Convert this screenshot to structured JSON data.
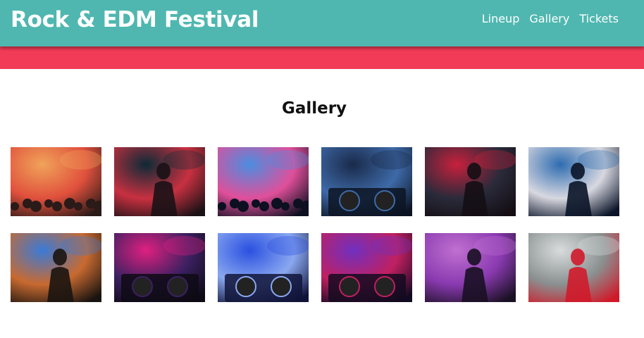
{
  "header": {
    "title": "Rock & EDM Festival",
    "nav": [
      {
        "label": "Lineup"
      },
      {
        "label": "Gallery"
      },
      {
        "label": "Tickets"
      }
    ]
  },
  "main": {
    "heading": "Gallery",
    "photos": [
      {
        "subject": "crowd-concert-sunset",
        "colors": [
          "#f0a35a",
          "#e0503c",
          "#2a1a18"
        ]
      },
      {
        "subject": "rock-singer-stage",
        "colors": [
          "#0d2a36",
          "#c83040",
          "#1a1216"
        ]
      },
      {
        "subject": "edm-crowd-lights",
        "colors": [
          "#4a8de0",
          "#e04f9a",
          "#0c1020"
        ]
      },
      {
        "subject": "dj-turntables",
        "colors": [
          "#1a2a4a",
          "#3e6aa8",
          "#0c1422"
        ]
      },
      {
        "subject": "guitarist-red-light",
        "colors": [
          "#c8203c",
          "#2a2a3a",
          "#140e14"
        ]
      },
      {
        "subject": "guitarist-blue-stage",
        "colors": [
          "#2e6cb0",
          "#d8d8e0",
          "#0a1428"
        ]
      },
      {
        "subject": "electric-guitar-closeup",
        "colors": [
          "#3a7ad8",
          "#c86a30",
          "#1a1410"
        ]
      },
      {
        "subject": "dj-laptop-neon",
        "colors": [
          "#e02080",
          "#3a2060",
          "#0e0a14"
        ]
      },
      {
        "subject": "dj-mixer-blue",
        "colors": [
          "#2a50e0",
          "#8aa8f0",
          "#101438"
        ]
      },
      {
        "subject": "dj-controller-purple",
        "colors": [
          "#7030c0",
          "#c02060",
          "#120a20"
        ]
      },
      {
        "subject": "two-guitarists-stage",
        "colors": [
          "#c070d0",
          "#8a3ab0",
          "#1a1024"
        ]
      },
      {
        "subject": "singer-smoke",
        "colors": [
          "#d8dcdc",
          "#8a9090",
          "#d01a2a"
        ]
      }
    ]
  }
}
